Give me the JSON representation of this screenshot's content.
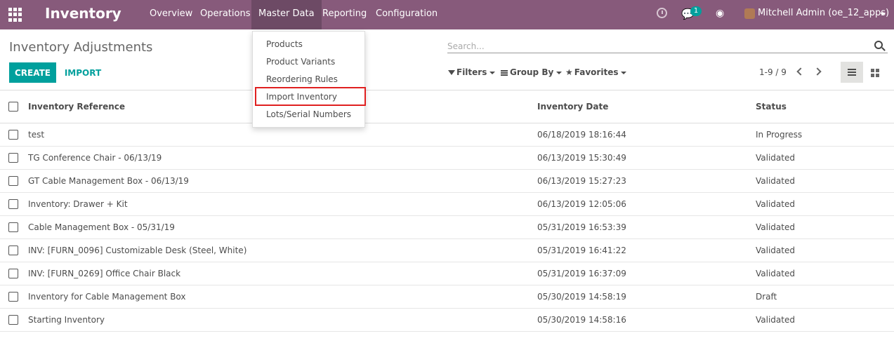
{
  "navbar": {
    "app_title": "Inventory",
    "menu": [
      {
        "label": "Overview",
        "active": false
      },
      {
        "label": "Operations",
        "active": false
      },
      {
        "label": "Master Data",
        "active": true
      },
      {
        "label": "Reporting",
        "active": false
      },
      {
        "label": "Configuration",
        "active": false
      }
    ],
    "chat_badge": "1",
    "user_name": "Mitchell Admin (oe_12_apps)"
  },
  "control_panel": {
    "title": "Inventory Adjustments",
    "search_placeholder": "Search...",
    "create_label": "CREATE",
    "import_label": "IMPORT",
    "filters_label": "Filters",
    "groupby_label": "Group By",
    "favorites_label": "Favorites",
    "pager": "1-9 / 9"
  },
  "master_data_menu": {
    "items": [
      "Products",
      "Product Variants",
      "Reordering Rules",
      "Import Inventory",
      "Lots/Serial Numbers"
    ],
    "highlighted": "Import Inventory"
  },
  "table": {
    "columns": [
      "Inventory Reference",
      "Inventory Date",
      "Status"
    ],
    "rows": [
      {
        "reference": "test",
        "date": "06/18/2019 18:16:44",
        "status": "In Progress"
      },
      {
        "reference": "TG Conference Chair - 06/13/19",
        "date": "06/13/2019 15:30:49",
        "status": "Validated"
      },
      {
        "reference": "GT Cable Management Box - 06/13/19",
        "date": "06/13/2019 15:27:23",
        "status": "Validated"
      },
      {
        "reference": "Inventory: Drawer + Kit",
        "date": "06/13/2019 12:05:06",
        "status": "Validated"
      },
      {
        "reference": "Cable Management Box - 05/31/19",
        "date": "05/31/2019 16:53:39",
        "status": "Validated"
      },
      {
        "reference": "INV: [FURN_0096] Customizable Desk (Steel, White)",
        "date": "05/31/2019 16:41:22",
        "status": "Validated"
      },
      {
        "reference": "INV: [FURN_0269] Office Chair Black",
        "date": "05/31/2019 16:37:09",
        "status": "Validated"
      },
      {
        "reference": "Inventory for Cable Management Box",
        "date": "05/30/2019 14:58:19",
        "status": "Draft"
      },
      {
        "reference": "Starting Inventory",
        "date": "05/30/2019 14:58:16",
        "status": "Validated"
      }
    ]
  },
  "colors": {
    "navbar": "#875a7b",
    "navbar_active": "#6d4a65",
    "primary_button": "#00a09d",
    "highlight_box": "#e02020"
  },
  "icons": [
    "apps-grid-icon",
    "clock-icon",
    "chat-icon",
    "bug-icon",
    "avatar",
    "search-icon",
    "filter-icon",
    "group-by-icon",
    "star-icon",
    "chevron-left-icon",
    "chevron-right-icon",
    "list-view-icon",
    "kanban-view-icon"
  ]
}
